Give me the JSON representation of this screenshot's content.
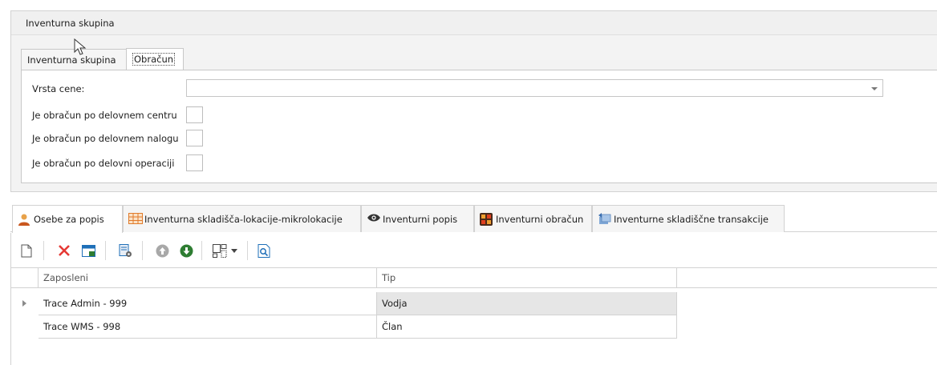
{
  "group": {
    "title": "Inventurna skupina",
    "inner_tabs": [
      {
        "label": "Inventurna skupina"
      },
      {
        "label": "Obračun"
      }
    ],
    "form": {
      "price_type_label": "Vrsta cene:",
      "price_type_value": "",
      "check_work_center_label": "Je obračun po delovnem centru",
      "check_work_order_label": "Je obračun po delovnem nalogu",
      "check_operation_label": "Je obračun po delovni operaciji"
    }
  },
  "tabs": [
    {
      "label": "Osebe za popis",
      "icon": "person-icon"
    },
    {
      "label": "Inventurna skladišča-lokacije-mikrolokacije",
      "icon": "grid-table-icon"
    },
    {
      "label": "Inventurni popis",
      "icon": "eye-icon"
    },
    {
      "label": "Inventurni obračun",
      "icon": "calculator-icon"
    },
    {
      "label": "Inventurne skladiščne transakcije",
      "icon": "transactions-icon"
    }
  ],
  "toolbar": {
    "icons": [
      "new-icon",
      "delete-icon",
      "window-icon",
      "settings-list-icon",
      "move-up-icon",
      "move-down-icon",
      "layout-icon",
      "dropdown-arrow-icon",
      "preview-icon"
    ]
  },
  "grid": {
    "columns": [
      "Zaposleni",
      "Tip"
    ],
    "rows": [
      {
        "employee": "Trace Admin - 999",
        "type": "Vodja"
      },
      {
        "employee": "Trace WMS - 998",
        "type": "Član"
      }
    ]
  },
  "colors": {
    "accent_red": "#e53935",
    "accent_green": "#2e7d32",
    "accent_blue": "#1e6fb8",
    "selected_cell": "#e6e6e6"
  }
}
